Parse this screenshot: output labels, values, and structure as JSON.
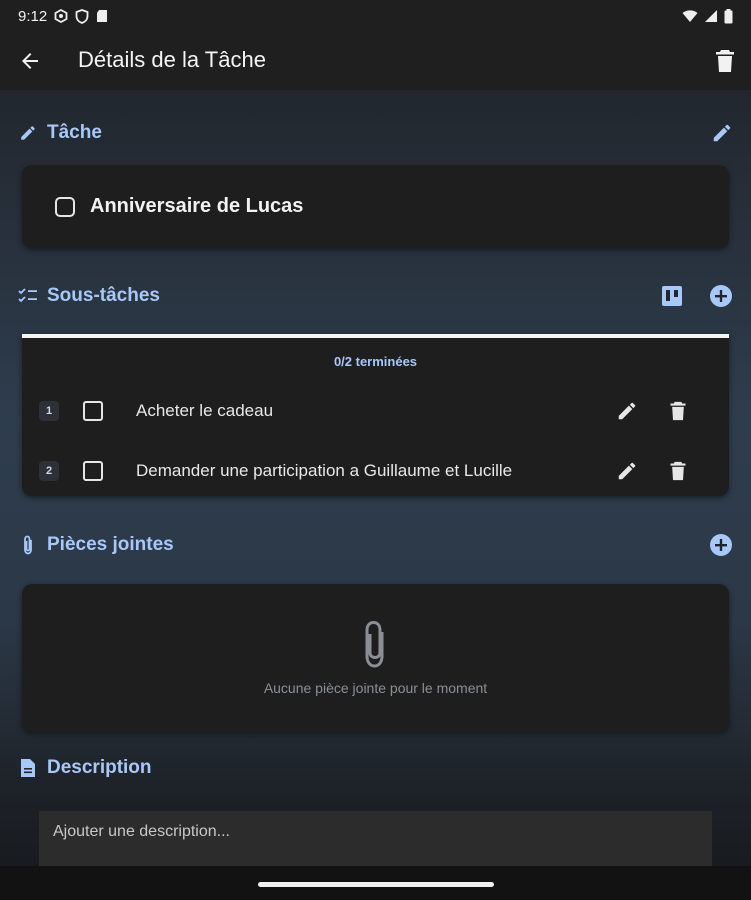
{
  "status_bar": {
    "time": "9:12"
  },
  "app_bar": {
    "title": "Détails de la Tâche"
  },
  "task_section": {
    "header": "Tâche",
    "task_title": "Anniversaire de Lucas"
  },
  "subtasks_section": {
    "header": "Sous-tâches",
    "progress": "0/2 terminées",
    "items": [
      {
        "number": "1",
        "label": "Acheter le cadeau"
      },
      {
        "number": "2",
        "label": "Demander une participation a Guillaume et Lucille"
      }
    ]
  },
  "attachments_section": {
    "header": "Pièces jointes",
    "empty_text": "Aucune pièce jointe pour le moment"
  },
  "description_section": {
    "header": "Description",
    "placeholder": "Ajouter une description..."
  },
  "colors": {
    "accent": "#a8c8f8",
    "card": "#1e1e1f",
    "bar": "#1f1f1f"
  }
}
